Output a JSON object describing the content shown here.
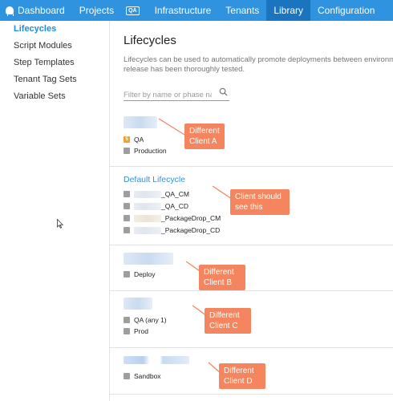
{
  "nav": {
    "items": [
      {
        "label": "Dashboard",
        "icon": "octopus-logo-icon",
        "active": false
      },
      {
        "label": "Projects",
        "active": false
      },
      {
        "label": "",
        "badge": "QA",
        "active": false
      },
      {
        "label": "Infrastructure",
        "active": false
      },
      {
        "label": "Tenants",
        "active": false
      },
      {
        "label": "Library",
        "active": true
      },
      {
        "label": "Configuration",
        "active": false
      }
    ]
  },
  "sidebar": {
    "items": [
      {
        "label": "Lifecycles",
        "active": true
      },
      {
        "label": "Script Modules",
        "active": false
      },
      {
        "label": "Step Templates",
        "active": false
      },
      {
        "label": "Tenant Tag Sets",
        "active": false
      },
      {
        "label": "Variable Sets",
        "active": false
      }
    ]
  },
  "main": {
    "title": "Lifecycles",
    "intro_line1": "Lifecycles can be used to automatically promote deployments between environments, and limit env",
    "intro_line2": "release has been thoroughly tested.",
    "filter_placeholder": "Filter by name or phase nam...",
    "lifecycles": [
      {
        "name": "",
        "phases": [
          {
            "label": "QA",
            "badge": "5"
          },
          {
            "label": "Production"
          }
        ]
      },
      {
        "name": "Default Lifecycle",
        "phases": [
          {
            "label": "_QA_CM"
          },
          {
            "label": "_QA_CD"
          },
          {
            "label": "_PackageDrop_CM"
          },
          {
            "label": "_PackageDrop_CD"
          }
        ]
      },
      {
        "name": "",
        "phases": [
          {
            "label": "Deploy"
          }
        ]
      },
      {
        "name": "",
        "phases": [
          {
            "label": "QA (any 1)"
          },
          {
            "label": "Prod"
          }
        ]
      },
      {
        "name": "",
        "phases": [
          {
            "label": "Sandbox"
          }
        ]
      }
    ]
  },
  "annotations": [
    {
      "line1": "Different",
      "line2": "Client A"
    },
    {
      "line1": "Client should",
      "line2": "see this"
    },
    {
      "line1": "Different",
      "line2": "Client B"
    },
    {
      "line1": "Different",
      "line2": "Client C"
    },
    {
      "line1": "Different",
      "line2": "Client D"
    }
  ],
  "colors": {
    "nav": "#2f93e0",
    "nav_active": "#1a74be",
    "link": "#2f93e0",
    "callout": "#f4855e"
  }
}
